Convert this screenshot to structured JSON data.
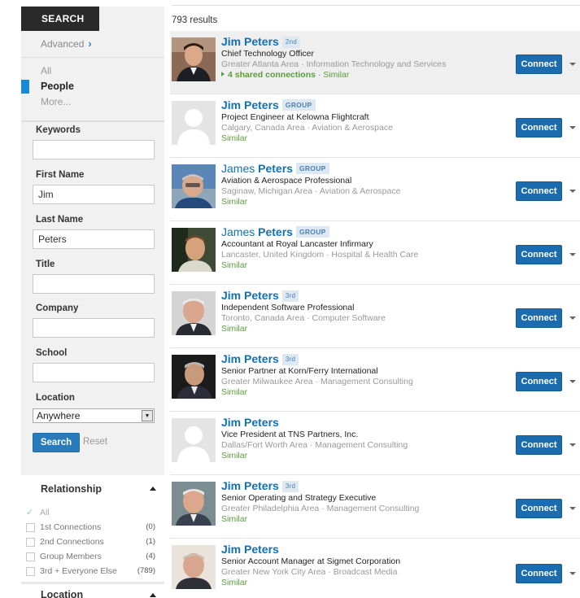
{
  "sidebar": {
    "search_tab": "SEARCH",
    "advanced": "Advanced",
    "nav": [
      {
        "label": "All"
      },
      {
        "label": "People"
      },
      {
        "label": "More..."
      }
    ],
    "fields": {
      "keywords": {
        "label": "Keywords",
        "value": ""
      },
      "first_name": {
        "label": "First Name",
        "value": "Jim"
      },
      "last_name": {
        "label": "Last Name",
        "value": "Peters"
      },
      "title": {
        "label": "Title",
        "value": ""
      },
      "company": {
        "label": "Company",
        "value": ""
      },
      "school": {
        "label": "School",
        "value": ""
      },
      "location": {
        "label": "Location",
        "value": "Anywhere"
      }
    },
    "search_button": "Search",
    "reset": "Reset",
    "relationship": {
      "title": "Relationship",
      "rows": [
        {
          "label": "All",
          "count": ""
        },
        {
          "label": "1st Connections",
          "count": "(0)"
        },
        {
          "label": "2nd Connections",
          "count": "(1)"
        },
        {
          "label": "Group Members",
          "count": "(4)"
        },
        {
          "label": "3rd + Everyone Else",
          "count": "(789)"
        }
      ]
    },
    "location_section": {
      "title": "Location"
    }
  },
  "results": {
    "count_text": "793 results",
    "connect_label": "Connect",
    "items": [
      {
        "first": "Jim",
        "last": "Peters",
        "badge": "2nd",
        "headline": "Chief Technology Officer",
        "meta": "Greater Atlanta Area · Information Technology and Services",
        "shared": "4 shared connections",
        "similar": "Similar"
      },
      {
        "first": "Jim",
        "last": "Peters",
        "badge": "GROUP",
        "headline": "Project Engineer at Kelowna Flightcraft",
        "meta": "Calgary, Canada Area · Aviation & Aerospace",
        "similar": "Similar"
      },
      {
        "first": "James",
        "last": "Peters",
        "badge": "GROUP",
        "headline": "Aviation & Aerospace Professional",
        "meta": "Saginaw, Michigan Area · Aviation & Aerospace",
        "similar": "Similar"
      },
      {
        "first": "James",
        "last": "Peters",
        "badge": "GROUP",
        "headline": "Accountant at Royal Lancaster Infirmary",
        "meta": "Lancaster, United Kingdom · Hospital & Health Care",
        "similar": "Similar"
      },
      {
        "first": "Jim",
        "last": "Peters",
        "badge": "3rd",
        "headline": "Independent Software Professional",
        "meta": "Toronto, Canada Area · Computer Software",
        "similar": "Similar"
      },
      {
        "first": "Jim",
        "last": "Peters",
        "badge": "3rd",
        "headline": "Senior Partner at Korn/Ferry International",
        "meta": "Greater Milwaukee Area · Management Consulting",
        "similar": "Similar"
      },
      {
        "first": "Jim",
        "last": "Peters",
        "badge": "",
        "headline": "Vice President at TNS Partners, Inc.",
        "meta": "Dallas/Fort Worth Area · Management Consulting",
        "similar": "Similar"
      },
      {
        "first": "Jim",
        "last": "Peters",
        "badge": "3rd",
        "headline": "Senior Operating and Strategy Executive",
        "meta": "Greater Philadelphia Area · Management Consulting",
        "similar": "Similar"
      },
      {
        "first": "Jim",
        "last": "Peters",
        "badge": "",
        "headline": "Senior Account Manager at Sigmet Corporation",
        "meta": "Greater New York City Area · Broadcast Media",
        "similar": "Similar"
      }
    ]
  }
}
